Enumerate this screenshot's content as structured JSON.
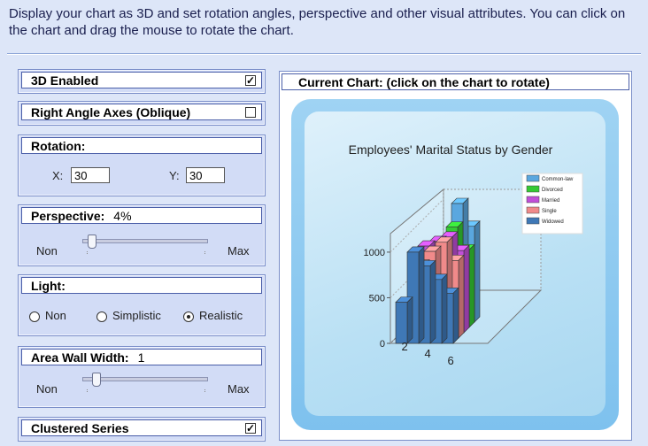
{
  "description": "Display your chart as 3D and set rotation angles, perspective and other visual attributes. You can click on the chart and drag the mouse to rotate the chart.",
  "options": {
    "enabled3d": {
      "label": "3D Enabled",
      "checked": true,
      "check_mark": "✓"
    },
    "right_angle": {
      "label": "Right Angle Axes (Oblique)",
      "checked": false
    },
    "rotation": {
      "label": "Rotation:",
      "x_label": "X:",
      "x_value": "30",
      "y_label": "Y:",
      "y_value": "30"
    },
    "perspective": {
      "label": "Perspective:",
      "value": "4%",
      "min_label": "Non",
      "max_label": "Max",
      "level": 0.04
    },
    "light": {
      "label": "Light:",
      "options": [
        "Non",
        "Simplistic",
        "Realistic"
      ],
      "selected": "Realistic"
    },
    "area_wall": {
      "label": "Area Wall Width:",
      "value": "1",
      "min_label": "Non",
      "max_label": "Max",
      "level": 0.08
    },
    "clustered": {
      "label": "Clustered Series",
      "checked": true,
      "check_mark": "✓"
    }
  },
  "chart_panel": {
    "header": "Current Chart: (click on the chart to rotate)"
  },
  "chart_data": {
    "type": "bar",
    "title": "Employees' Marital Status by Gender",
    "x_ticks": [
      "2",
      "4",
      "6"
    ],
    "y_ticks": [
      "0",
      "500",
      "1000"
    ],
    "ylim": [
      0,
      1300
    ],
    "series": [
      {
        "name": "Common-law",
        "color": "#5aa7df",
        "values": [
          1300,
          1050
        ]
      },
      {
        "name": "Divorced",
        "color": "#34c934",
        "values": [
          1100,
          850
        ]
      },
      {
        "name": "Married",
        "color": "#c04fd8",
        "values": [
          950,
          1000,
          1050,
          900
        ]
      },
      {
        "name": "Single",
        "color": "#f08a8a",
        "values": [
          800,
          950,
          1050,
          850
        ]
      },
      {
        "name": "Widowed",
        "color": "#3f78b6",
        "values": [
          450,
          1000,
          850,
          700,
          550
        ]
      }
    ]
  }
}
